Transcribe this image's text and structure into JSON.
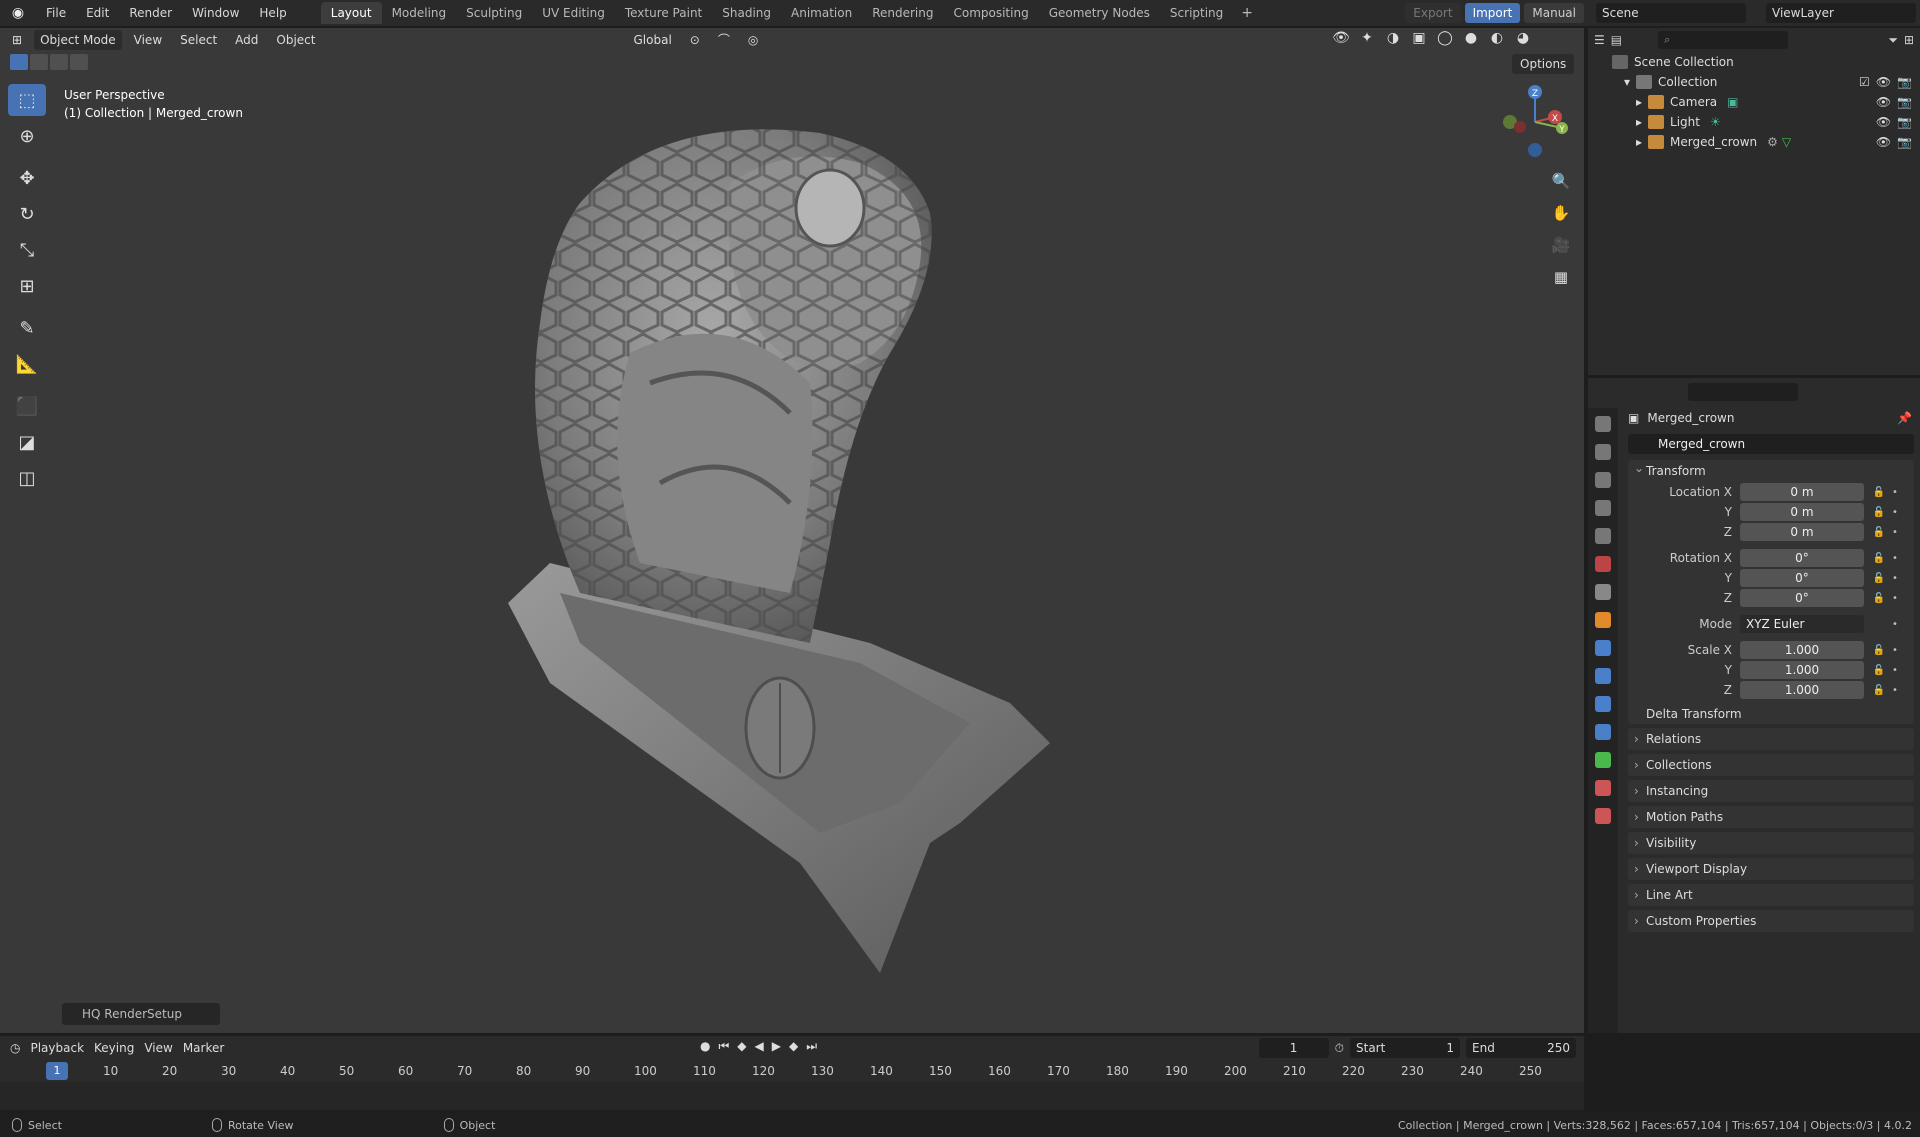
{
  "app": {
    "name": "Blender"
  },
  "menu": [
    "File",
    "Edit",
    "Render",
    "Window",
    "Help"
  ],
  "workspaces": [
    "Layout",
    "Modeling",
    "Sculpting",
    "UV Editing",
    "Texture Paint",
    "Shading",
    "Animation",
    "Rendering",
    "Compositing",
    "Geometry Nodes",
    "Scripting"
  ],
  "active_workspace": "Layout",
  "topbar": {
    "export": "Export",
    "import": "Import",
    "manual": "Manual",
    "scene": "Scene",
    "view_layer": "ViewLayer"
  },
  "viewport": {
    "mode": "Object Mode",
    "menus": [
      "View",
      "Select",
      "Add",
      "Object"
    ],
    "transform_orientation": "Global",
    "options": "Options",
    "perspective": "User Perspective",
    "collection_info": "(1) Collection | Merged_crown",
    "hq_render": "HQ RenderSetup"
  },
  "gizmo": {
    "x": "X",
    "y": "Y",
    "z": "Z"
  },
  "outliner": {
    "scene_collection": "Scene Collection",
    "collection": "Collection",
    "items": [
      "Camera",
      "Light",
      "Merged_crown"
    ]
  },
  "properties": {
    "object_name": "Merged_crown",
    "object_field": "Merged_crown",
    "transform_label": "Transform",
    "location_x_label": "Location X",
    "rotation_x_label": "Rotation X",
    "scale_x_label": "Scale X",
    "y_label": "Y",
    "z_label": "Z",
    "mode_label": "Mode",
    "location": [
      "0 m",
      "0 m",
      "0 m"
    ],
    "rotation": [
      "0°",
      "0°",
      "0°"
    ],
    "rotation_mode": "XYZ Euler",
    "scale": [
      "1.000",
      "1.000",
      "1.000"
    ],
    "delta_transform": "Delta Transform",
    "panels": [
      "Relations",
      "Collections",
      "Instancing",
      "Motion Paths",
      "Visibility",
      "Viewport Display",
      "Line Art",
      "Custom Properties"
    ]
  },
  "timeline": {
    "menus": [
      "Playback",
      "Keying",
      "View",
      "Marker"
    ],
    "current_frame": "1",
    "start_label": "Start",
    "start": "1",
    "end_label": "End",
    "end": "250",
    "ticks": [
      "10",
      "20",
      "30",
      "40",
      "50",
      "60",
      "70",
      "80",
      "90",
      "100",
      "110",
      "120",
      "130",
      "140",
      "150",
      "160",
      "170",
      "180",
      "190",
      "200",
      "210",
      "220",
      "230",
      "240",
      "250"
    ]
  },
  "statusbar": {
    "left": [
      "Select",
      "Rotate View",
      "Object"
    ],
    "stats": "Collection | Merged_crown | Verts:328,562 | Faces:657,104 | Tris:657,104 | Objects:0/3 | 4.0.2"
  },
  "colors": {
    "accent": "#4772b3",
    "viewport_bg": "#393939",
    "panel_bg": "#2b2b2b"
  }
}
